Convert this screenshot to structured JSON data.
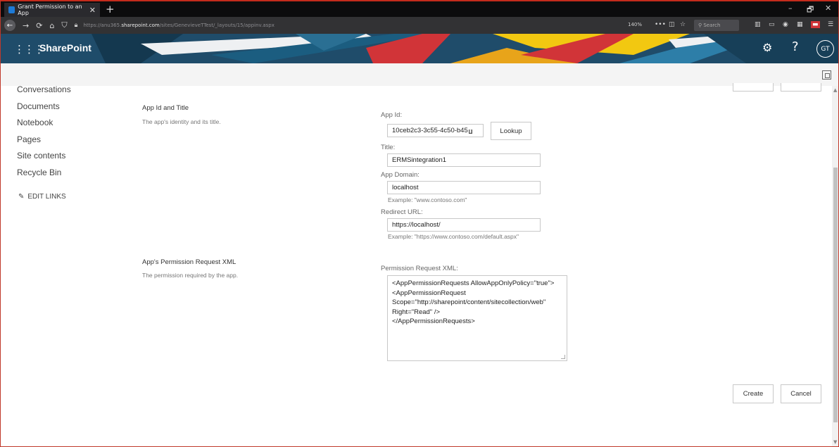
{
  "browser": {
    "tab_title": "Grant Permission to an App",
    "tab_close": "✕",
    "new_tab": "+",
    "url_prefix": "https://anu365.",
    "url_host": "sharepoint.com",
    "url_path": "/sites/GenevieveTTest/_layouts/15/appinv.aspx",
    "zoom": "140%",
    "search_placeholder": "Search",
    "controls": {
      "minimize": "–",
      "restore": "🗗",
      "close": "✕"
    }
  },
  "suitebar": {
    "app_name": "SharePoint",
    "avatar_initials": "GT",
    "help": "?"
  },
  "leftnav": {
    "items": [
      "Conversations",
      "Documents",
      "Notebook",
      "Pages",
      "Site contents",
      "Recycle Bin"
    ],
    "edit_links": "EDIT LINKS"
  },
  "section1": {
    "title": "App Id and Title",
    "description": "The app's identity and its title."
  },
  "section2": {
    "title": "App's Permission Request XML",
    "description": "The permission required by the app."
  },
  "form": {
    "app_id_label": "App Id:",
    "app_id_value": "10ceb2c3-3c55-4c50-b45",
    "lookup_button": "Lookup",
    "title_label": "Title:",
    "title_value": "ERMSintegration1",
    "app_domain_label": "App Domain:",
    "app_domain_value": "localhost",
    "app_domain_example": "Example: \"www.contoso.com\"",
    "redirect_label": "Redirect URL:",
    "redirect_value": "https://localhost/",
    "redirect_example": "Example: \"https://www.contoso.com/default.aspx\"",
    "xml_label": "Permission Request XML:",
    "xml_lines": [
      "<AppPermissionRequests AllowAppOnlyPolicy=\"true\">",
      "<AppPermissionRequest",
      "Scope=\"http://sharepoint/content/sitecollection/web\"",
      "Right=\"Read\" />",
      "</AppPermissionRequests>"
    ]
  },
  "actions": {
    "create": "Create",
    "cancel": "Cancel"
  },
  "colors": {
    "suitebar": "#1f4c6a",
    "accent_red": "#d13438",
    "accent_yellow": "#f2c811"
  }
}
